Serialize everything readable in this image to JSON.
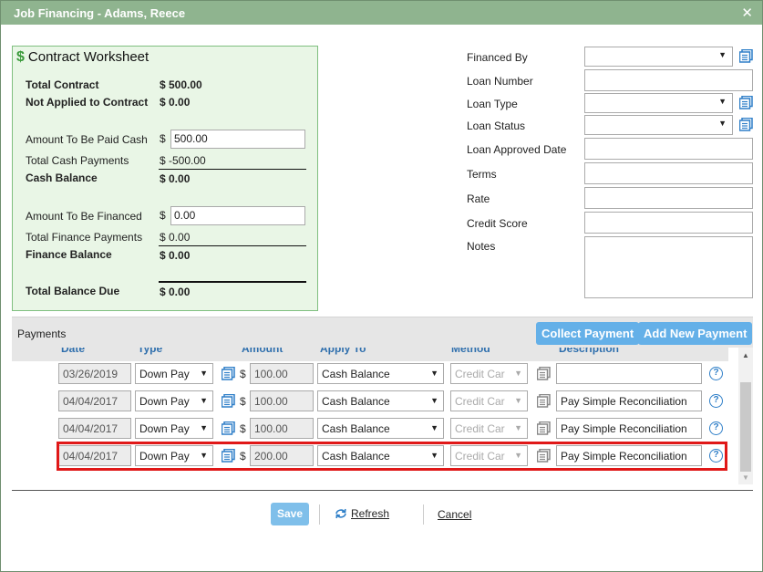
{
  "window": {
    "title": "Job Financing - Adams, Reece",
    "close_icon": "close-icon"
  },
  "worksheet": {
    "title": "Contract Worksheet",
    "dollar_icon": "$",
    "total_contract_label": "Total Contract",
    "total_contract_value": "$ 500.00",
    "not_applied_label": "Not Applied to Contract",
    "not_applied_value": "$ 0.00",
    "paid_cash_label": "Amount To Be Paid Cash",
    "paid_cash_currency": "$",
    "paid_cash_value": "500.00",
    "total_cash_payments_label": "Total Cash Payments",
    "total_cash_payments_value": "$ -500.00",
    "cash_balance_label": "Cash Balance",
    "cash_balance_value": "$ 0.00",
    "financed_label": "Amount To Be Financed",
    "financed_currency": "$",
    "financed_value": "0.00",
    "total_finance_payments_label": "Total Finance Payments",
    "total_finance_payments_value": "$ 0.00",
    "finance_balance_label": "Finance Balance",
    "finance_balance_value": "$ 0.00",
    "total_balance_due_label": "Total Balance Due",
    "total_balance_due_value": "$ 0.00"
  },
  "form": {
    "financed_by_label": "Financed By",
    "financed_by_value": "",
    "loan_number_label": "Loan Number",
    "loan_number_value": "",
    "loan_type_label": "Loan Type",
    "loan_type_value": "",
    "loan_status_label": "Loan Status",
    "loan_status_value": "",
    "loan_approved_date_label": "Loan Approved Date",
    "loan_approved_date_value": "",
    "terms_label": "Terms",
    "terms_value": "",
    "rate_label": "Rate",
    "rate_value": "",
    "credit_score_label": "Credit Score",
    "credit_score_value": "",
    "notes_label": "Notes",
    "notes_value": ""
  },
  "payments": {
    "section_label": "Payments",
    "collect_payment_label": "Collect Payment",
    "add_new_payment_label": "Add New Payment",
    "columns": [
      "Date",
      "Type",
      "Amount",
      "Apply To",
      "Method",
      "Description"
    ],
    "currency": "$",
    "rows": [
      {
        "date": "03/26/2019",
        "type": "Down Pay",
        "amount": "100.00",
        "apply_to": "Cash Balance",
        "method": "Credit Car",
        "description": ""
      },
      {
        "date": "04/04/2017",
        "type": "Down Pay",
        "amount": "100.00",
        "apply_to": "Cash Balance",
        "method": "Credit Car",
        "description": "Pay Simple Reconciliation"
      },
      {
        "date": "04/04/2017",
        "type": "Down Pay",
        "amount": "100.00",
        "apply_to": "Cash Balance",
        "method": "Credit Car",
        "description": "Pay Simple Reconciliation"
      },
      {
        "date": "04/04/2017",
        "type": "Down Pay",
        "amount": "200.00",
        "apply_to": "Cash Balance",
        "method": "Credit Car",
        "description": "Pay Simple Reconciliation"
      }
    ]
  },
  "footer": {
    "save_label": "Save",
    "refresh_label": "Refresh",
    "cancel_label": "Cancel"
  },
  "colors": {
    "title_bar": "#8fb48f",
    "worksheet_bg": "#e9f6e6",
    "accent_blue": "#64b0e8",
    "highlight_red": "#e01818"
  }
}
